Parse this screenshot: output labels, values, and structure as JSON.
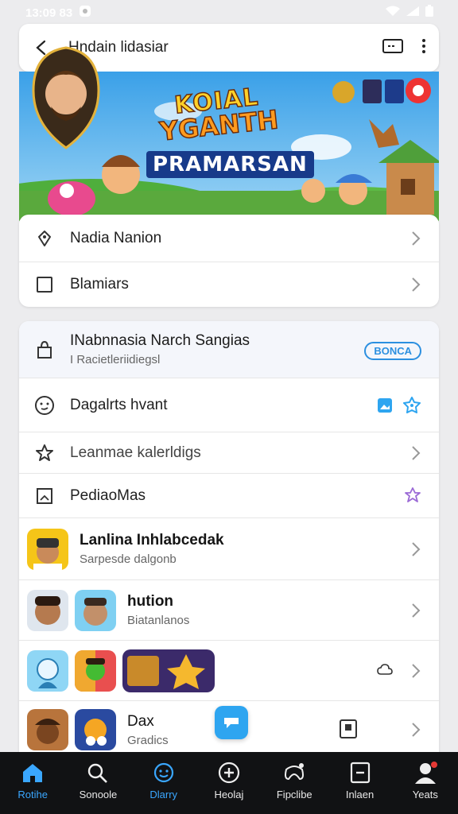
{
  "status_bar": {
    "time": "13:09 83"
  },
  "app_bar": {
    "title": "Hndain lidasiar"
  },
  "banner": {
    "line1": "KOIAL",
    "line2": "YGANTH",
    "line3": "PRAMARSAN"
  },
  "card1": {
    "items": [
      {
        "label": "Nadia Nanion",
        "icon": "tag-icon"
      },
      {
        "label": "Blamiars",
        "icon": "square-icon"
      }
    ]
  },
  "card2": {
    "header": {
      "title": "INabnnasia Narch Sangias",
      "subtitle": "I Racietleriidiegsl",
      "pill": "BONCA",
      "icon": "bag-icon"
    },
    "rows": [
      {
        "label": "Dagalrts hvant",
        "icon": "smiley-icon"
      },
      {
        "label": "Leanmae kalerldigs",
        "icon": "star-icon"
      },
      {
        "label": "PediaoMas",
        "icon": "frame-icon"
      }
    ],
    "games": [
      {
        "title": "Lanlina Inhlabcedak",
        "subtitle": "Sarpesde dalgonb"
      },
      {
        "title": "hution",
        "subtitle": "Biatanlanos"
      },
      {
        "title": "",
        "subtitle": ""
      },
      {
        "title": "Dax",
        "subtitle": "Gradics"
      }
    ]
  },
  "bottom_nav": {
    "items": [
      {
        "label": "Rotihe",
        "icon": "home-icon",
        "active": true
      },
      {
        "label": "Sonoole",
        "icon": "search-icon",
        "active": false
      },
      {
        "label": "Dlarry",
        "icon": "smile-badge-icon",
        "active": true
      },
      {
        "label": "Heolaj",
        "icon": "plus-circle-icon",
        "active": false
      },
      {
        "label": "Fipclibe",
        "icon": "gamepad-icon",
        "active": false
      },
      {
        "label": "Inlaen",
        "icon": "minus-box-icon",
        "active": false
      },
      {
        "label": "Yeats",
        "icon": "person-icon",
        "active": false
      }
    ]
  },
  "colors": {
    "accent": "#2b8fe0",
    "nav_bg": "#111214",
    "active": "#3aa7ff"
  }
}
